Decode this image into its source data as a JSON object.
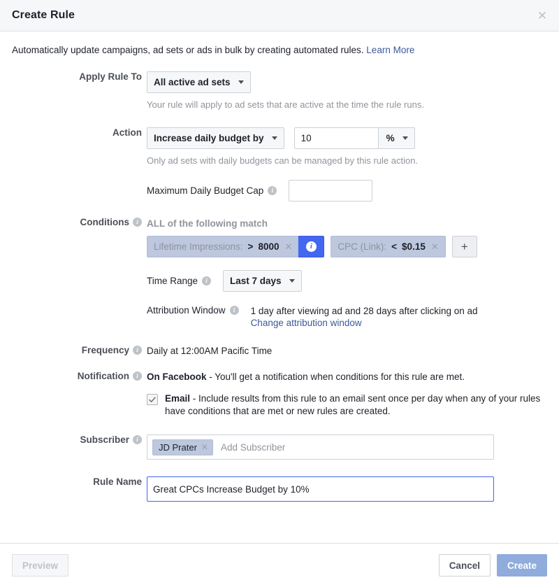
{
  "dialog": {
    "title": "Create Rule",
    "close_label": "✕",
    "intro_text": "Automatically update campaigns, ad sets or ads in bulk by creating automated rules.",
    "intro_link": "Learn More"
  },
  "apply_rule_to": {
    "label": "Apply Rule To",
    "selected": "All active ad sets",
    "helper": "Your rule will apply to ad sets that are active at the time the rule runs."
  },
  "action": {
    "label": "Action",
    "selected": "Increase daily budget by",
    "amount": "10",
    "unit": "%",
    "helper": "Only ad sets with daily budgets can be managed by this rule action.",
    "cap_label": "Maximum Daily Budget Cap",
    "cap_value": "",
    "cap_placeholder": ""
  },
  "conditions": {
    "label": "Conditions",
    "match_text": "ALL of the following match",
    "items": [
      {
        "name": "Lifetime Impressions:",
        "operator": ">",
        "value": "8000",
        "remove": "✕",
        "has_info": true
      },
      {
        "name": "CPC (Link):",
        "operator": "<",
        "value": "$0.15",
        "remove": "✕",
        "has_info": false
      }
    ],
    "add_label": "+",
    "time_range_label": "Time Range",
    "time_range_value": "Last 7 days",
    "attribution_label": "Attribution Window",
    "attribution_value": "1 day after viewing ad and 28 days after clicking on ad",
    "attribution_link": "Change attribution window"
  },
  "frequency": {
    "label": "Frequency",
    "value": "Daily at 12:00AM Pacific Time"
  },
  "notification": {
    "label": "Notification",
    "fb_bold": "On Facebook",
    "fb_rest": " - You'll get a notification when conditions for this rule are met.",
    "email_checked": true,
    "email_bold": "Email",
    "email_rest": " - Include results from this rule to an email sent once per day when any of your rules have conditions that are met or new rules are created."
  },
  "subscriber": {
    "label": "Subscriber",
    "pills": [
      {
        "name": "JD Prater",
        "remove": "✕"
      }
    ],
    "placeholder": "Add Subscriber"
  },
  "rule_name": {
    "label": "Rule Name",
    "value": "Great CPCs Increase Budget by 10%",
    "placeholder": ""
  },
  "footer": {
    "preview_label": "Preview",
    "cancel_label": "Cancel",
    "create_label": "Create"
  },
  "colors": {
    "accent_blue": "#4267f1",
    "link_blue": "#3b5998",
    "token_blue": "#bdc7de",
    "primary_muted": "#8facdc",
    "muted_gray": "#90949c"
  }
}
